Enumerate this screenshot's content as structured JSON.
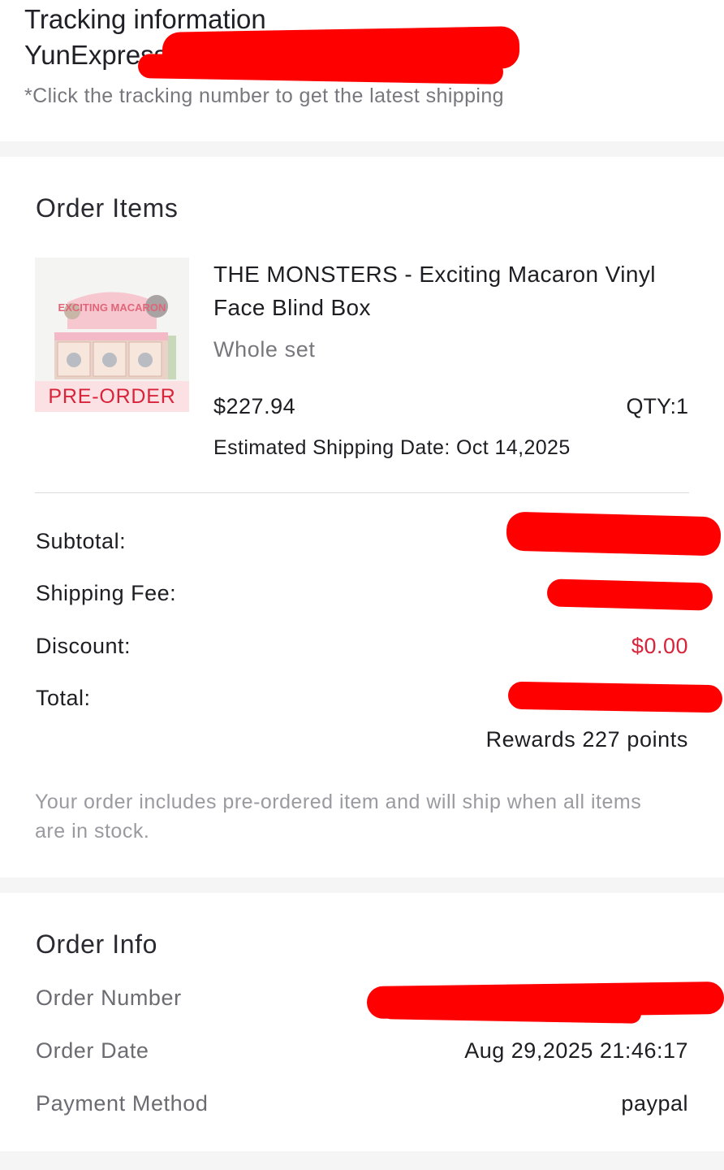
{
  "tracking": {
    "title": "Tracking information",
    "carrier": "YunExpress:",
    "note": "*Click the tracking number to get the latest shipping"
  },
  "order_items": {
    "title": "Order Items",
    "product": {
      "name": "THE MONSTERS - Exciting Macaron Vinyl Face Blind Box",
      "variant": "Whole set",
      "badge": "PRE-ORDER",
      "price": "$227.94",
      "qty": "QTY:1",
      "estimated_shipping": "Estimated Shipping Date: Oct 14,2025",
      "image_text": "EXCITING MACARON"
    },
    "summary": {
      "subtotal_label": "Subtotal:",
      "shipping_label": "Shipping Fee:",
      "discount_label": "Discount:",
      "discount_value": "$0.00",
      "total_label": "Total:",
      "rewards": "Rewards 227 points"
    },
    "notice": "Your order includes pre-ordered item and will ship when all items are in stock."
  },
  "order_info": {
    "title": "Order Info",
    "order_number_label": "Order Number",
    "order_date_label": "Order Date",
    "order_date": "Aug 29,2025 21:46:17",
    "payment_label": "Payment Method",
    "payment_value": "paypal"
  },
  "colors": {
    "accent_red": "#d8243a",
    "badge_bg": "#fbe1e4",
    "redaction": "#ff0000",
    "page_bg": "#f5f5f6"
  }
}
